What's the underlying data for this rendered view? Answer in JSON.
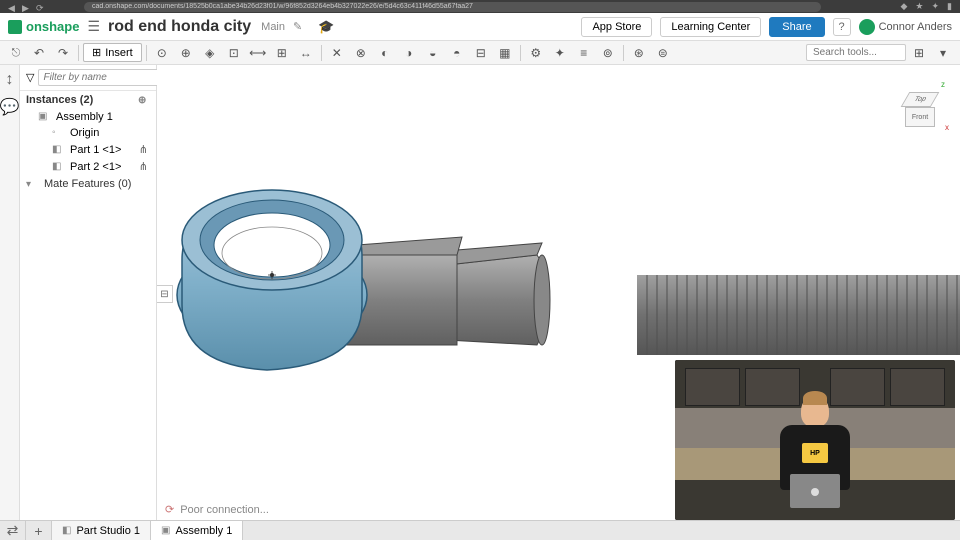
{
  "browser": {
    "url": "cad.onshape.com/documents/18525b0ca1abe34b26d23f01/w/96f852d3264eb4b327022e26/e/5d4c63c411f46d55a67faa27"
  },
  "header": {
    "brand": "onshape",
    "doc_title": "rod end honda city",
    "doc_sub": "Main",
    "app_store": "App Store",
    "learning_center": "Learning Center",
    "share": "Share",
    "user_name": "Connor Anders"
  },
  "toolbar": {
    "insert": "Insert",
    "search_placeholder": "Search tools..."
  },
  "panel": {
    "filter_placeholder": "Filter by name",
    "instances_label": "Instances (2)",
    "assembly": "Assembly 1",
    "origin": "Origin",
    "part1": "Part 1 <1>",
    "part2": "Part 2 <1>",
    "mate_features": "Mate Features (0)"
  },
  "viewcube": {
    "top": "Top",
    "front": "Front",
    "x": "x",
    "z": "z"
  },
  "status": {
    "message": "Poor connection..."
  },
  "tabs": {
    "part_studio": "Part Studio 1",
    "assembly": "Assembly 1"
  },
  "webcam": {
    "shirt_text": "HP"
  }
}
